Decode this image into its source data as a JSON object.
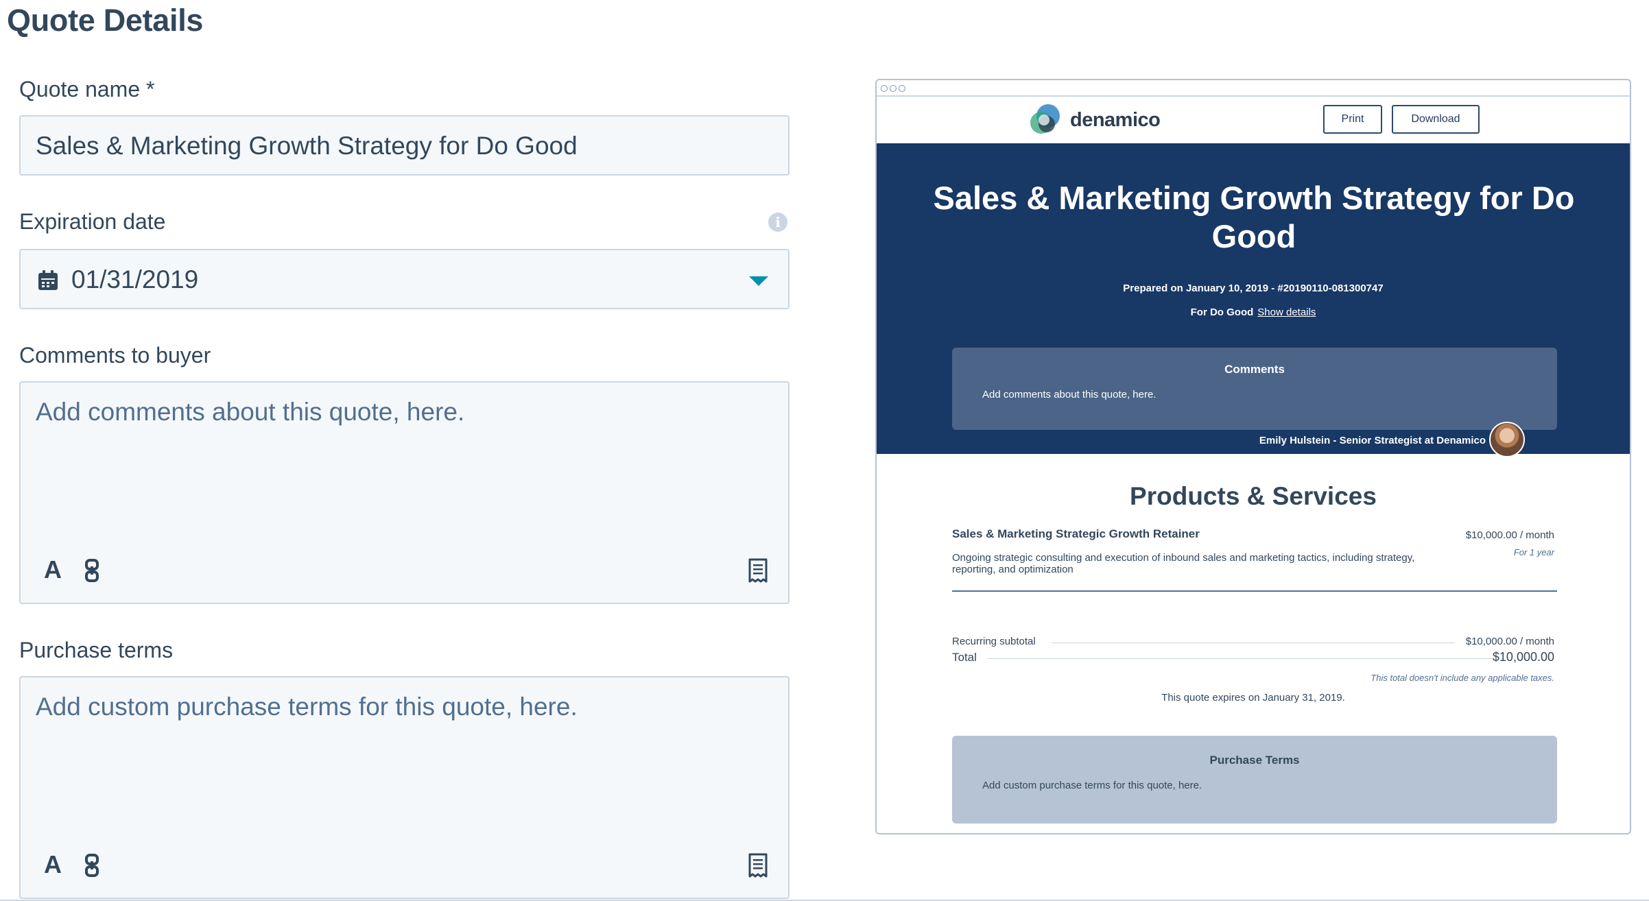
{
  "page": {
    "title": "Quote Details"
  },
  "form": {
    "quote_name": {
      "label": "Quote name *",
      "value": "Sales & Marketing Growth Strategy for Do Good"
    },
    "expiration": {
      "label": "Expiration date",
      "value": "01/31/2019",
      "info_icon": "info-icon"
    },
    "comments": {
      "label": "Comments to buyer",
      "placeholder": "Add comments about this quote, here."
    },
    "terms": {
      "label": "Purchase terms",
      "placeholder": "Add custom purchase terms for this quote, here."
    },
    "toolbar": {
      "format_glyph": "A",
      "link_glyph": "Ȣ",
      "snippet_icon": "document-icon"
    }
  },
  "preview": {
    "logo_text": "denamico",
    "print_label": "Print",
    "download_label": "Download",
    "title": "Sales & Marketing Growth Strategy for Do Good",
    "prepared": "Prepared on January 10, 2019 - #20190110-081300747",
    "for_label": "For Do Good",
    "show_details": "Show details",
    "comments_title": "Comments",
    "comments_body": "Add comments about this quote, here.",
    "signer": "Emily Hulstein - Senior Strategist at Denamico",
    "products_title": "Products & Services",
    "line_item": {
      "name": "Sales & Marketing Strategic Growth Retainer",
      "price": "$10,000.00 / month",
      "term": "For 1 year",
      "description": "Ongoing strategic consulting and execution of inbound sales and marketing tactics, including strategy, reporting, and optimization"
    },
    "recurring_label": "Recurring subtotal",
    "recurring_value": "$10,000.00 / month",
    "total_label": "Total",
    "total_value": "$10,000.00",
    "tax_note": "This total doesn't include any applicable taxes.",
    "expires": "This quote expires on January 31, 2019.",
    "terms_title": "Purchase Terms",
    "terms_body": "Add custom purchase terms for this quote, here."
  },
  "colors": {
    "hero": "#183866",
    "accent": "#0091ae",
    "text": "#33475b",
    "field_bg": "#f5f8fa"
  }
}
